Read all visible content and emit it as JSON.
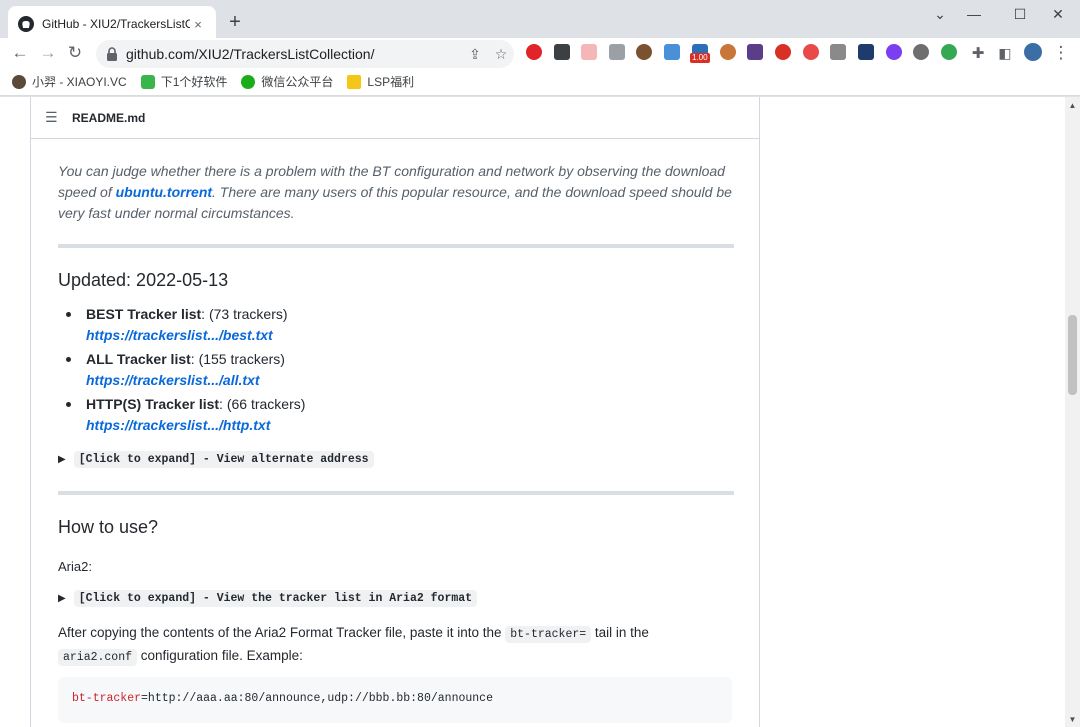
{
  "browser": {
    "tab_title": "GitHub - XIU2/TrackersListColl",
    "tab_close": "×",
    "new_tab": "+",
    "url": "github.com/XIU2/TrackersListCollection/",
    "window": {
      "minimize": "⌄",
      "restore": "—",
      "maximize": "☐",
      "close": "✕"
    },
    "ext_badge": "1.00",
    "bookmarks": [
      {
        "label": "小羿 - XIAOYI.VC",
        "color": "#5b4a3a"
      },
      {
        "label": "下1个好软件",
        "color": "#3ab54a"
      },
      {
        "label": "微信公众平台",
        "color": "#1aad19"
      },
      {
        "label": "LSP福利",
        "color": "#f5c518"
      }
    ]
  },
  "readme": {
    "filename": "README.md",
    "intro_part1": "You can judge whether there is a problem with the BT configuration and network by observing the download speed of ",
    "intro_link": "ubuntu.torrent",
    "intro_part2": ". There are many users of this popular resource, and the download speed should be very fast under normal circumstances.",
    "updated_heading": "Updated: 2022-05-13",
    "lists": [
      {
        "name": "BEST Tracker list",
        "count": ": (73 trackers)",
        "url": "https://trackerslist.../best.txt"
      },
      {
        "name": "ALL Tracker list",
        "count": ": (155 trackers)",
        "url": "https://trackerslist.../all.txt"
      },
      {
        "name": "HTTP(S) Tracker list",
        "count": ": (66 trackers)",
        "url": "https://trackerslist.../http.txt"
      }
    ],
    "expand_alternate": "[Click to expand] - View alternate address",
    "howto_heading": "How to use?",
    "aria2_label": "Aria2:",
    "expand_aria2": "[Click to expand] - View the tracker list in Aria2 format",
    "para_part1": "After copying the contents of the Aria2 Format Tracker file, paste it into the ",
    "code_bt_tracker": "bt-tracker=",
    "para_part2": " tail in the ",
    "code_aria2_conf": "aria2.conf",
    "para_part3": " configuration file. Example:",
    "code_key": "bt-tracker",
    "code_value": "=http://aaa.aa:80/announce,udp://bbb.bb:80/announce"
  }
}
